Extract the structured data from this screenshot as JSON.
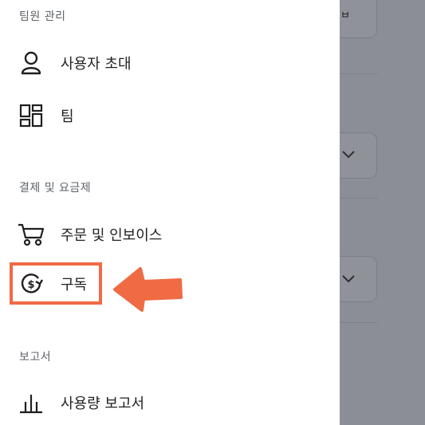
{
  "background_page": {
    "peek_text": "ㅂ"
  },
  "drawer": {
    "sections": [
      {
        "title": "팀원 관리",
        "items": [
          {
            "label": "사용자 초대",
            "icon": "user-icon"
          },
          {
            "label": "팀",
            "icon": "grid-icon"
          }
        ]
      },
      {
        "title": "결제 및 요금제",
        "items": [
          {
            "label": "주문 및 인보이스",
            "icon": "cart-icon"
          },
          {
            "label": "구독",
            "icon": "dollar-refresh-icon",
            "highlighted": true
          }
        ]
      },
      {
        "title": "보고서",
        "items": [
          {
            "label": "사용량 보고서",
            "icon": "bar-chart-icon"
          }
        ]
      }
    ]
  },
  "colors": {
    "highlight": "#f06a44",
    "backdrop": "#8b8f95",
    "text": "#1f1f1f",
    "section_title": "#5f6368"
  }
}
